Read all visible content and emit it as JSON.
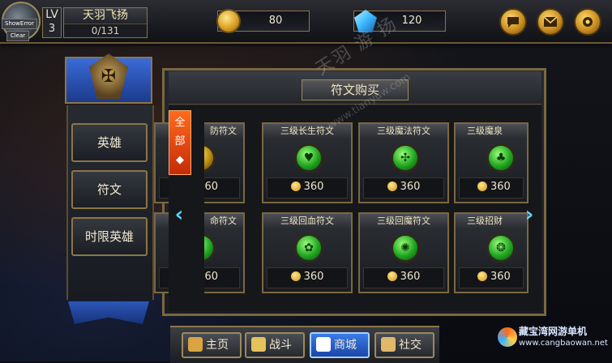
{
  "debug": {
    "show_error": "ShowError",
    "clear": "Clear"
  },
  "player": {
    "lv_label": "LV",
    "level": "3",
    "name": "天羽飞扬",
    "exp": "0/131"
  },
  "resources": {
    "coins": "80",
    "gems": "120"
  },
  "top_icons": [
    "chat-icon",
    "mail-icon",
    "settings-gear-icon"
  ],
  "left_menu": [
    {
      "label": "英雄"
    },
    {
      "label": "符文"
    },
    {
      "label": "时限英雄"
    }
  ],
  "panel": {
    "title": "符文购买",
    "tab_all": [
      "全",
      "部"
    ],
    "tab_arrow": "◆"
  },
  "cards": [
    {
      "name": "防符文",
      "price": "360",
      "orb": "gold"
    },
    {
      "name": "三级长生符文",
      "price": "360",
      "orb": "green"
    },
    {
      "name": "三级魔法符文",
      "price": "360",
      "orb": "green"
    },
    {
      "name": "三级魔泉",
      "price": "360",
      "orb": "green"
    },
    {
      "name": "命符文",
      "price": "360",
      "orb": "green"
    },
    {
      "name": "三级回血符文",
      "price": "360",
      "orb": "green"
    },
    {
      "name": "三级回魔符文",
      "price": "360",
      "orb": "green"
    },
    {
      "name": "三级招财",
      "price": "360",
      "orb": "green"
    }
  ],
  "nav": [
    {
      "label": "主页",
      "icon": "home-icon",
      "color": "#d9a441"
    },
    {
      "label": "战斗",
      "icon": "swords-icon",
      "color": "#e3c35a"
    },
    {
      "label": "商城",
      "icon": "shop-cart-icon",
      "color": "#ffffff"
    },
    {
      "label": "社交",
      "icon": "people-icon",
      "color": "#e0b86a"
    }
  ],
  "watermark": {
    "site_cn": "天羽 游 扬",
    "site_url": "www.tianyuw.com",
    "brand": "藏宝湾网游单机",
    "brand_url": "www.cangbaowan.net"
  }
}
